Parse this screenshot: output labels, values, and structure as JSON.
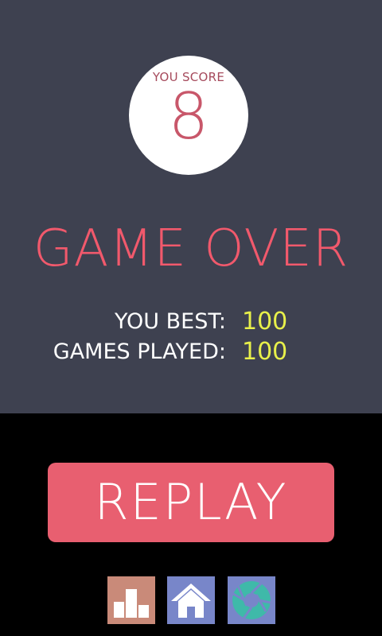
{
  "score": {
    "label": "YOU SCORE",
    "value": "8"
  },
  "title": "GAME OVER",
  "stats": {
    "best_label": "YOU BEST:",
    "best_value": "100",
    "played_label": "GAMES PLAYED:",
    "played_value": "100"
  },
  "replay_label": "REPLAY",
  "bottom_buttons": [
    {
      "icon": "bar-chart-icon",
      "color": "#c98a79"
    },
    {
      "icon": "home-icon",
      "color": "#7886c9"
    },
    {
      "icon": "camera-aperture-icon",
      "color": "#7886c9"
    }
  ],
  "colors": {
    "panel": "#3e4150",
    "title": "#f1596c",
    "stat_value": "#e8f04a",
    "replay": "#e85f70"
  }
}
